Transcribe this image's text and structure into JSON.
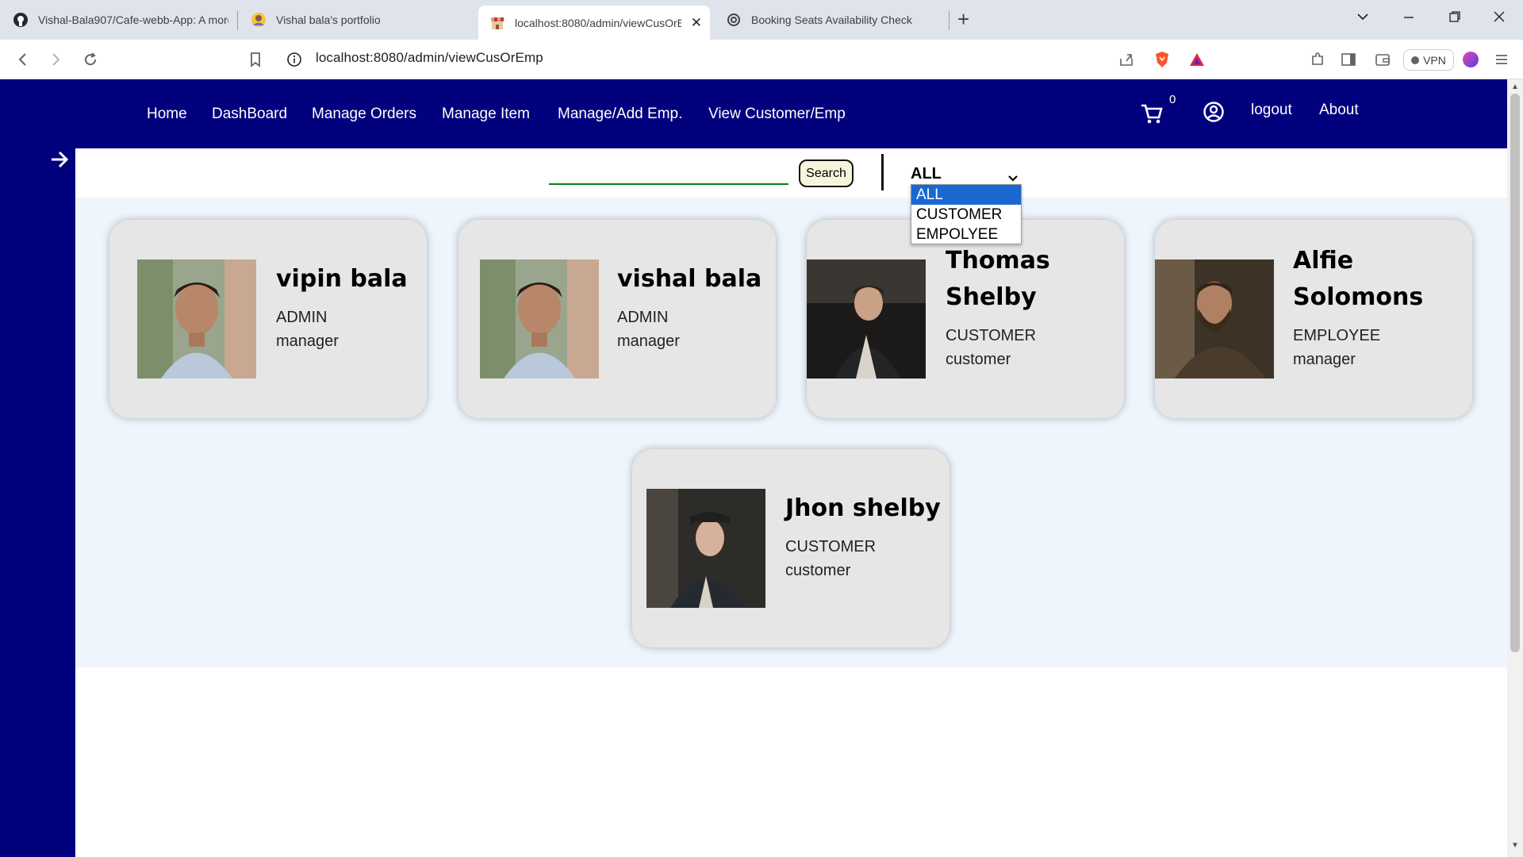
{
  "browser": {
    "tabs": [
      {
        "title": "Vishal-Bala907/Cafe-webb-App: A more"
      },
      {
        "title": "Vishal bala's portfolio"
      },
      {
        "title": "localhost:8080/admin/viewCusOrEm"
      },
      {
        "title": "Booking Seats Availability Check"
      }
    ],
    "url": "localhost:8080/admin/viewCusOrEmp",
    "vpn_label": "VPN"
  },
  "nav": {
    "links": [
      "Home",
      "DashBoard",
      "Manage Orders",
      "Manage Item",
      "Manage/Add Emp.",
      "View Customer/Emp"
    ],
    "cart_count": "0",
    "logout": "logout",
    "about": "About"
  },
  "search": {
    "value": "",
    "button_label": "Search",
    "filter_selected": "ALL",
    "filter_options": [
      "ALL",
      "CUSTOMER",
      "EMPOLYEE"
    ]
  },
  "users": [
    {
      "name_line1": "vipin bala",
      "name_line2": "",
      "role": "ADMIN",
      "position": "manager"
    },
    {
      "name_line1": "vishal bala",
      "name_line2": "",
      "role": "ADMIN",
      "position": "manager"
    },
    {
      "name_line1": "Thomas",
      "name_line2": "Shelby",
      "role": "CUSTOMER",
      "position": "customer"
    },
    {
      "name_line1": "Alfie",
      "name_line2": "Solomons",
      "role": "EMPLOYEE",
      "position": "manager"
    },
    {
      "name_line1": "Jhon shelby",
      "name_line2": "",
      "role": "CUSTOMER",
      "position": "customer"
    }
  ],
  "colors": {
    "nav_bg": "#01017e",
    "content_bg": "#eef5fc",
    "card_bg": "#e6e6e6",
    "search_underline": "#0b7d1b",
    "dropdown_selected": "#1a67d2"
  }
}
